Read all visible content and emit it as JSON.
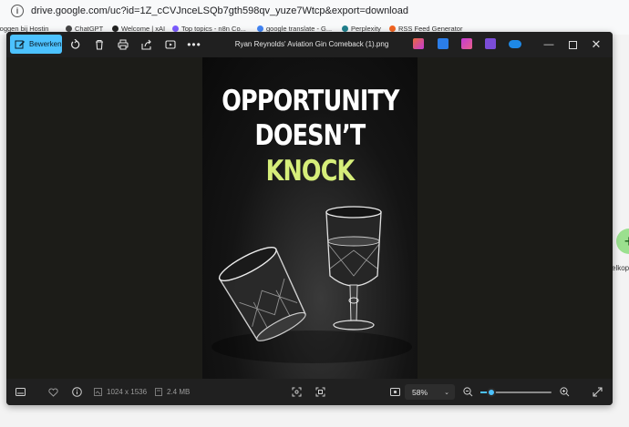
{
  "browser": {
    "url": "drive.google.com/uc?id=1Z_cCVJnceLSQb7gth598qv_yuze7Wtcp&export=download",
    "bookmarks": [
      {
        "label": "loggen bij Hostin",
        "color": "#2f7de1"
      },
      {
        "label": "ChatGPT",
        "color": "#444444"
      },
      {
        "label": "Welcome | xAI",
        "color": "#222222"
      },
      {
        "label": "Top topics - n8n Co...",
        "color": "#7c5cff"
      },
      {
        "label": "google translate - G...",
        "color": "#4285f4"
      },
      {
        "label": "Perplexity",
        "color": "#20808d"
      },
      {
        "label": "RSS Feed Generator",
        "color": "#f26522"
      }
    ],
    "side_label": "elkop"
  },
  "viewer": {
    "edit_label": "Bewerken",
    "title": "Ryan Reynolds' Aviation Gin Comeback (1).png",
    "app_colors": [
      "#e86a3c",
      "#2b7de9",
      "#c43bd6",
      "#7b4dd8",
      "#1e88e5"
    ]
  },
  "image": {
    "line1": "OPPORTUNITY",
    "line2": "DOESN’T",
    "line3": "KNOCK",
    "accent_color": "#d6ee7a"
  },
  "status": {
    "dimensions": "1024 x 1536",
    "file_size": "2.4 MB",
    "zoom": "58%",
    "zoom_fraction": 0.15
  }
}
